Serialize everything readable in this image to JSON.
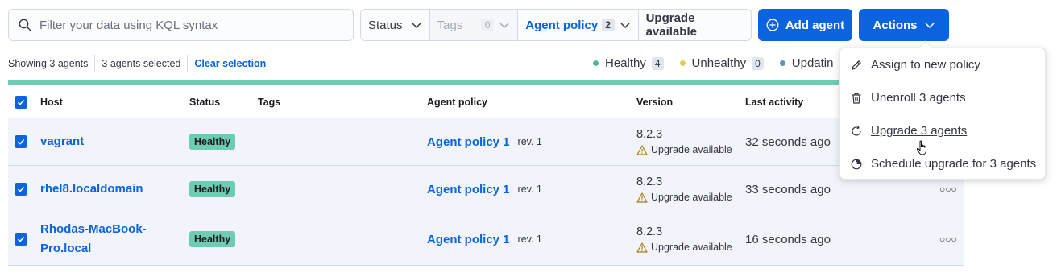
{
  "toolbar": {
    "search_placeholder": "Filter your data using KQL syntax",
    "filters": {
      "status": "Status",
      "tags": "Tags",
      "tags_count": "0",
      "agent_policy": "Agent policy",
      "agent_policy_count": "2",
      "upgrade_available": "Upgrade available"
    },
    "add_agent": "Add agent",
    "actions": "Actions"
  },
  "summary": {
    "showing": "Showing 3 agents",
    "selected": "3 agents selected",
    "clear": "Clear selection"
  },
  "legend": [
    {
      "label": "Healthy",
      "count": "4",
      "color": "#54b399"
    },
    {
      "label": "Unhealthy",
      "count": "0",
      "color": "#e7c95c"
    },
    {
      "label": "Updatin",
      "color": "#6092c0"
    }
  ],
  "table": {
    "columns": {
      "host": "Host",
      "status": "Status",
      "tags": "Tags",
      "agent_policy": "Agent policy",
      "version": "Version",
      "last_activity": "Last activity"
    },
    "rows": [
      {
        "host": "vagrant",
        "status": "Healthy",
        "policy": "Agent policy 1",
        "rev": "rev. 1",
        "version": "8.2.3",
        "upgrade": "Upgrade available",
        "activity": "32 seconds ago"
      },
      {
        "host": "rhel8.localdomain",
        "status": "Healthy",
        "policy": "Agent policy 1",
        "rev": "rev. 1",
        "version": "8.2.3",
        "upgrade": "Upgrade available",
        "activity": "33 seconds ago"
      },
      {
        "host": "Rhodas-MacBook-Pro.local",
        "status": "Healthy",
        "policy": "Agent policy 1",
        "rev": "rev. 1",
        "version": "8.2.3",
        "upgrade": "Upgrade available",
        "activity": "16 seconds ago"
      }
    ]
  },
  "menu": {
    "items": [
      {
        "label": "Assign to new policy",
        "icon": "pencil-icon"
      },
      {
        "label": "Unenroll 3 agents",
        "icon": "trash-icon"
      },
      {
        "label": "Upgrade 3 agents",
        "icon": "refresh-icon"
      },
      {
        "label": "Schedule upgrade for 3 agents",
        "icon": "clock-icon"
      }
    ]
  },
  "colors": {
    "primary": "#0b64dd",
    "healthy": "#6dccb1",
    "warning": "#e7c95c"
  }
}
